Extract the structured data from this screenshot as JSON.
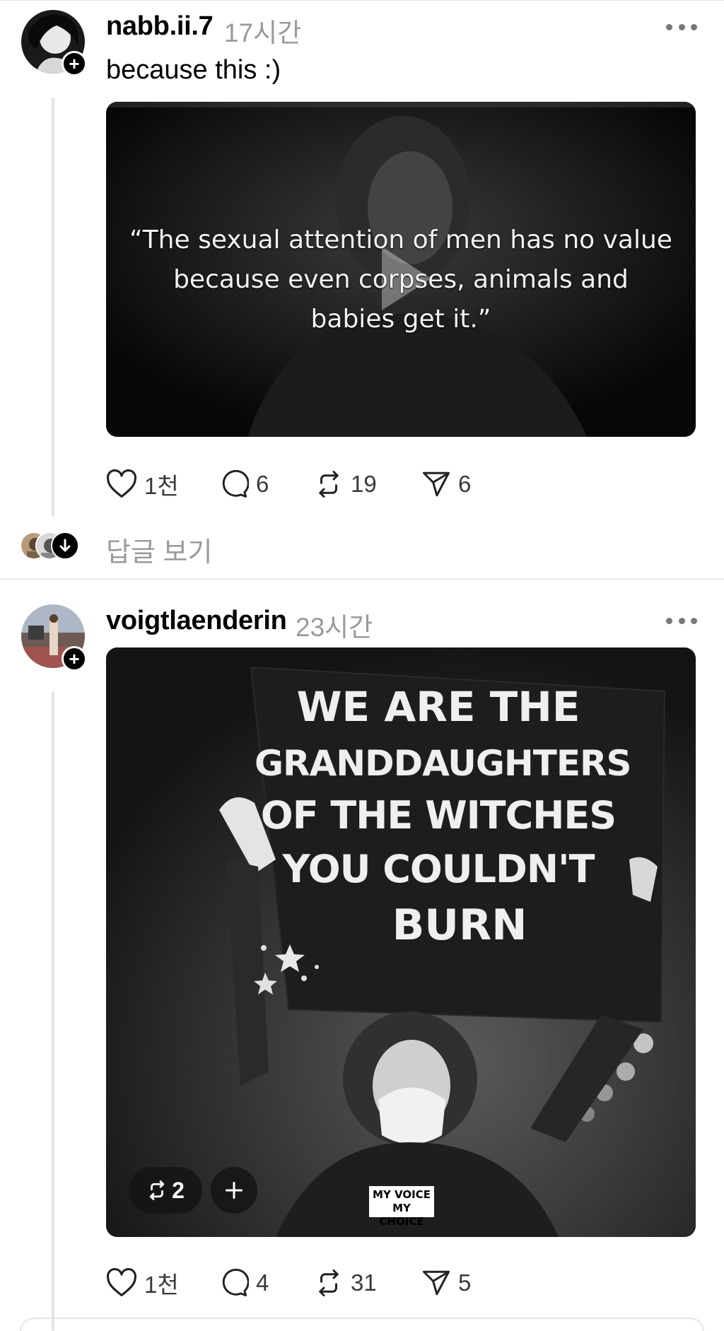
{
  "posts": [
    {
      "username": "nabb.ii.7",
      "time": "17시간",
      "caption": "because this :)",
      "media_quote": [
        "“The sexual attention of men has no value",
        "because even corpses, animals and",
        "babies get it.”"
      ],
      "likes": "1천",
      "comments": "6",
      "reposts": "19",
      "shares": "6"
    },
    {
      "username": "voigtlaenderin",
      "time": "23시간",
      "sign_lines": [
        "WE ARE THE",
        "GRANDDAUGHTERS",
        "OF THE WITCHES",
        "YOU COULDN'T",
        "BURN"
      ],
      "sticker_lines": [
        "MY VOICE",
        "MY CHOICE"
      ],
      "repost_pill": "2",
      "likes": "1천",
      "comments": "4",
      "reposts": "31",
      "shares": "5"
    }
  ],
  "view_replies": "답글 보기",
  "icons": {
    "like": "heart-icon",
    "comment": "comment-icon",
    "repost": "repost-icon",
    "share": "share-icon",
    "more": "more-icon",
    "follow": "plus-icon",
    "down": "arrow-down-icon"
  },
  "colors": {
    "muted": "#9a9a9a",
    "line": "#e3e3e3",
    "text": "#000000"
  }
}
